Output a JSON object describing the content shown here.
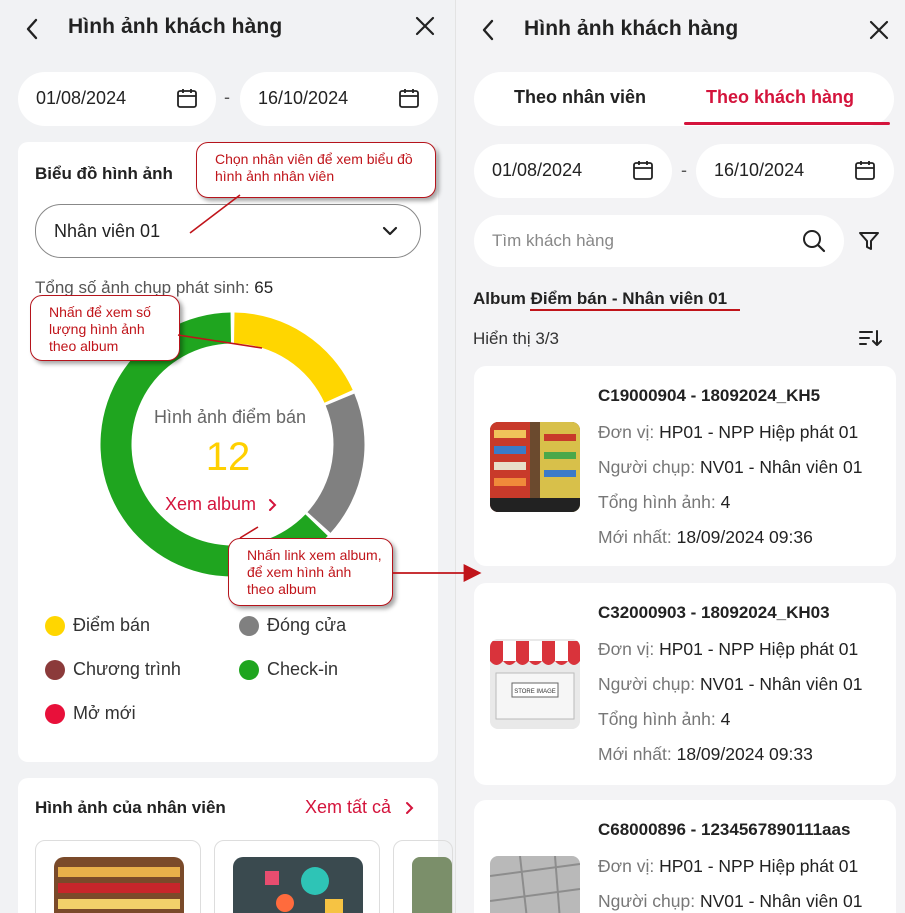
{
  "left": {
    "header": {
      "back_icon": "chevron-left-icon",
      "title": "Hình ảnh khách hàng",
      "close_icon": "close-icon"
    },
    "date_from": "01/08/2024",
    "date_sep": "-",
    "date_to": "16/10/2024",
    "chart_card": {
      "title": "Biểu đồ hình ảnh",
      "employee_select": "Nhân viên 01",
      "total_label": "Tổng số ảnh chụp phát sinh:",
      "total_value": "65",
      "donut_center_label": "Hình ảnh điểm bán",
      "donut_center_value": "12",
      "album_link": "Xem album"
    },
    "legend": [
      {
        "label": "Điểm bán",
        "color": "#FFD600"
      },
      {
        "label": "Đóng cửa",
        "color": "#808080"
      },
      {
        "label": "Chương trình",
        "color": "#8B3A3A"
      },
      {
        "label": "Check-in",
        "color": "#1FA51F"
      },
      {
        "label": "Mở mới",
        "color": "#E8103A"
      }
    ],
    "staff_card": {
      "title": "Hình ảnh của nhân viên",
      "see_all": "Xem tất cả"
    },
    "callouts": {
      "select_hint": "Chọn nhân viên để xem biểu đồ hình ảnh nhân viên",
      "chart_hint": "Nhấn để xem số lượng hình ảnh theo album",
      "album_hint": "Nhấn link xem album, để xem hình ảnh theo album"
    }
  },
  "chart_data": {
    "type": "pie",
    "categories": [
      "Điểm bán",
      "Đóng cửa",
      "Check-in"
    ],
    "values": [
      12,
      12,
      41
    ],
    "colors": [
      "#FFD600",
      "#808080",
      "#1FA51F"
    ],
    "total": 65
  },
  "right": {
    "header": {
      "back_icon": "chevron-left-icon",
      "title": "Hình ảnh khách hàng",
      "close_icon": "close-icon"
    },
    "tabs": [
      {
        "label": "Theo nhân viên"
      },
      {
        "label": "Theo khách hàng"
      }
    ],
    "date_from": "01/08/2024",
    "date_sep": "-",
    "date_to": "16/10/2024",
    "search_placeholder": "Tìm khách hàng",
    "album_title": "Album Điểm bán - Nhân viên 01",
    "showing": "Hiển thị 3/3",
    "labels": {
      "unit": "Đơn vị:",
      "shooter": "Người chụp:",
      "total": "Tổng hình ảnh:",
      "latest": "Mới nhất:"
    },
    "items": [
      {
        "code": "C19000904 - 18092024_KH5",
        "unit": "HP01 - NPP Hiệp phát 01",
        "shooter": "NV01 - Nhân viên 01",
        "total": "4",
        "latest": "18/09/2024 09:36"
      },
      {
        "code": "C32000903 - 18092024_KH03",
        "unit": "HP01 - NPP Hiệp phát 01",
        "shooter": "NV01 - Nhân viên 01",
        "total": "4",
        "latest": "18/09/2024 09:33",
        "thumb_text": "STORE IMAGE"
      },
      {
        "code": "C68000896 - 1234567890111aas",
        "unit": "HP01 - NPP Hiệp phát 01",
        "shooter": "NV01 - Nhân viên 01"
      }
    ]
  }
}
